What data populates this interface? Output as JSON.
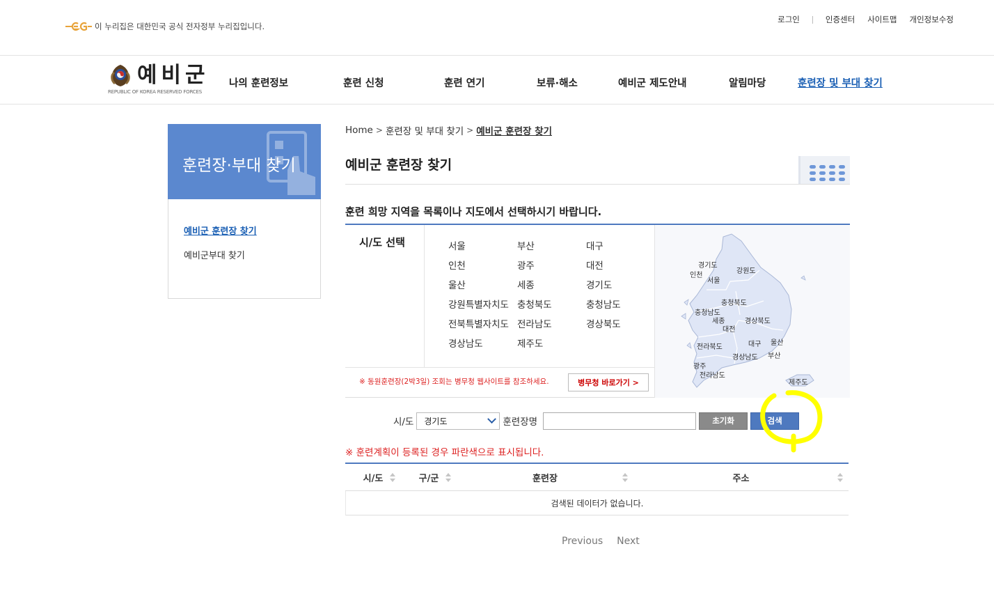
{
  "gov_notice": "이 누리집은 대한민국 공식 전자정부 누리집입니다.",
  "util_links": [
    "로그인",
    "인증센터",
    "사이트맵",
    "개인정보수정"
  ],
  "brand": {
    "name": "예비군",
    "sub": "REPUBLIC OF KOREA RESERVED FORCES"
  },
  "gnb": [
    "나의 훈련정보",
    "훈련 신청",
    "훈련 연기",
    "보류·해소",
    "예비군 제도안내",
    "알림마당",
    "훈련장 및 부대 찾기"
  ],
  "lnb": {
    "title": "훈련장·부대 찾기",
    "items": [
      "예비군 훈련장 찾기",
      "예비군부대 찾기"
    ]
  },
  "breadcrumb": [
    "Home",
    "훈련장 및 부대 찾기",
    "예비군 훈련장 찾기"
  ],
  "page_title": "예비군 훈련장 찾기",
  "instruction": "훈련 희망 지역을 목록이나 지도에서 선택하시기 바랍니다.",
  "region": {
    "label": "시/도 선택",
    "list": [
      "서울",
      "부산",
      "대구",
      "인천",
      "광주",
      "대전",
      "울산",
      "세종",
      "경기도",
      "강원특별자치도",
      "충청북도",
      "충청남도",
      "전북특별자치도",
      "전라남도",
      "경상북도",
      "경상남도",
      "제주도"
    ],
    "notice": "※ 동원훈련장(2박3일) 조회는 병무청 웹사이트를 참조하세요.",
    "mma_button": "병무청 바로가기 >"
  },
  "map_labels": [
    "경기도",
    "인천",
    "서울",
    "강원도",
    "충청북도",
    "충청남도",
    "세종",
    "대전",
    "경상북도",
    "전라북도",
    "대구",
    "울산",
    "경상남도",
    "부산",
    "광주",
    "전라남도",
    "제주도"
  ],
  "search": {
    "sido_label": "시/도",
    "sido_value": "경기도",
    "name_label": "훈련장명",
    "name_value": "",
    "reset_label": "초기화",
    "search_label": "검색"
  },
  "plan_notice": "※ 훈련계획이 등록된 경우 파란색으로 표시됩니다.",
  "table": {
    "headers": [
      "시/도",
      "구/군",
      "훈련장",
      "주소"
    ],
    "empty": "검색된 데이터가 없습니다."
  },
  "pager": {
    "prev": "Previous",
    "next": "Next"
  },
  "colors": {
    "accent": "#4e79bf",
    "lnb_head": "#5b88cf",
    "notice_red": "#dd2222",
    "annotation": "#ffff00"
  }
}
